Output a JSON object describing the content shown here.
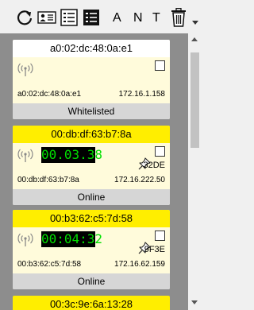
{
  "toolbar": {
    "icons": [
      "refresh-icon",
      "id-card-icon",
      "list-icon",
      "list-selected-icon",
      "trash-icon"
    ],
    "letters": [
      "A",
      "N",
      "T"
    ]
  },
  "colors": {
    "online_header": "#ffee00",
    "whitelisted_header": "#ffffff",
    "card_bg": "#fffbdb",
    "footer_bg": "#d6d6d6",
    "timer_text": "#00e000"
  },
  "devices": [
    {
      "mac": "a0:02:dc:48:0a:e1",
      "mac_small": "a0:02:dc:48:0a:e1",
      "ip": "172.16.1.158",
      "status": "Whitelisted",
      "timer": "",
      "code": ""
    },
    {
      "mac": "00:db:df:63:b7:8a",
      "mac_small": "00:db:df:63:b7:8a",
      "ip": "172.16.222.50",
      "status": "Online",
      "timer": "00.03.38",
      "code": "32DE"
    },
    {
      "mac": "00:b3:62:c5:7d:58",
      "mac_small": "00:b3:62:c5:7d:58",
      "ip": "172.16.62.159",
      "status": "Online",
      "timer": "00:04:32",
      "code": "9F3E"
    },
    {
      "mac": "00:3c:9e:6a:13:28"
    }
  ]
}
